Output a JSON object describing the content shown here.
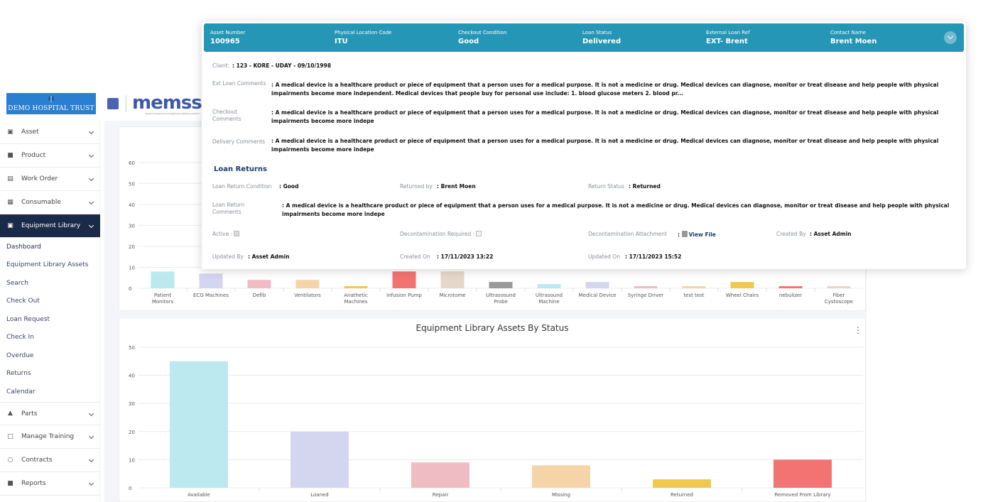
{
  "logo": {
    "text": "DEMO HOSPITAL TRUST",
    "brand": "memss",
    "brand_tag": "medical equipment management software solution"
  },
  "sidebar": {
    "items": [
      {
        "label": "Asset",
        "icon": "asset-icon"
      },
      {
        "label": "Product",
        "icon": "product-icon"
      },
      {
        "label": "Work Order",
        "icon": "work-order-icon"
      },
      {
        "label": "Consumable",
        "icon": "consumable-icon"
      },
      {
        "label": "Equipment Library",
        "icon": "equipment-library-icon"
      },
      {
        "label": "Parts",
        "icon": "parts-icon"
      },
      {
        "label": "Manage Training",
        "icon": "training-icon"
      },
      {
        "label": "Contracts",
        "icon": "contracts-icon"
      },
      {
        "label": "Reports",
        "icon": "reports-icon"
      }
    ],
    "sub_items": [
      "Dashboard",
      "Equipment Library Assets",
      "Search",
      "Check Out",
      "Loan Request",
      "Check In",
      "Overdue",
      "Returns",
      "Calendar"
    ]
  },
  "loan": {
    "header": [
      {
        "label": "Asset Number",
        "value": "100965"
      },
      {
        "label": "Physical Location Code",
        "value": "ITU"
      },
      {
        "label": "Checkout Condition",
        "value": "Good"
      },
      {
        "label": "Loan Status",
        "value": "Delivered"
      },
      {
        "label": "External Loan Ref",
        "value": "EXT- Brent"
      },
      {
        "label": "Contact Name",
        "value": "Brent Moen"
      }
    ],
    "client_label": "Client:",
    "client_value": ": 123 - KORE - UDAY - 09/10/1998",
    "ext_comments_label": "Ext Loan Comments",
    "ext_comments_value": ": A medical device is a healthcare product or piece of equipment that a person uses for a medical purpose. It is not a medicine or drug. Medical devices can diagnose, monitor or treat disease and help people with physical impairments become more independent. Medical devices that people buy for personal use include: 1. blood glucose meters 2. blood pr...",
    "checkout_comments_label": "Checkout Comments",
    "checkout_comments_value": ": A medical device is a healthcare product or piece of equipment that a person uses for a medical purpose. It is not a medicine or drug. Medical devices can diagnose, monitor or treat disease and help people with physical impairments become more indepe",
    "delivery_comments_label": "Delivery Comments",
    "delivery_comments_value": ": A medical device is a healthcare product or piece of equipment that a person uses for a medical purpose. It is not a medicine or drug. Medical devices can diagnose, monitor or treat disease and help people with physical impairments become more indepe",
    "returns_title": "Loan Returns",
    "return_condition_label": "Loan Return Condition",
    "return_condition_value": ": Good",
    "returned_by_label": "Returned by",
    "returned_by_value": ": Brent Moen",
    "return_status_label": "Return Status",
    "return_status_value": ": Returned",
    "return_comments_label": "Loan Return Comments",
    "return_comments_value": ": A medical device is a healthcare product or piece of equipment that a person uses for a medical purpose. It is not a medicine or drug. Medical devices can diagnose, monitor or treat disease and help people with physical impairments become more indepe",
    "active_label": "Active :",
    "decon_required_label": "Decontamination Required :",
    "decon_attachment_label": "Decontamination Attachment",
    "decon_attachment_sep": ":",
    "view_file": "View File",
    "created_by_label": "Created By",
    "created_by_value": ": Asset Admin",
    "updated_by_label": "Updated By",
    "updated_by_value": ": Asset Admin",
    "created_on_label": "Created On",
    "created_on_value": ": 17/11/2023 13:22",
    "updated_on_label": "Updated On",
    "updated_on_value": ": 17/11/2023 15:52"
  },
  "colors": {
    "accent": "#2596b5",
    "nav_active": "#1c2a4a",
    "brand": "#3e58a8"
  },
  "chart_data": [
    {
      "type": "bar",
      "title": "",
      "categories": [
        "Patient Monitors",
        "ECG Machines",
        "Defib",
        "Ventilators",
        "Anathetic Machines",
        "Infusion Pump",
        "Microtome",
        "Ultrasosund Probe",
        "Ultrasound Machine",
        "Medical Device",
        "Syringe Driver",
        "test test",
        "Wheel Chairs",
        "nebulizer",
        "Fiber Cystoscope"
      ],
      "values": [
        8,
        7,
        4,
        4,
        1,
        8,
        8,
        3,
        2,
        3,
        1,
        1,
        3,
        1,
        1
      ],
      "colors": [
        "#bce9f0",
        "#d4d6f0",
        "#f0bcc4",
        "#f5d4a8",
        "#f1c74c",
        "#f37373",
        "#e6d8c8",
        "#999999",
        "#bce9f0",
        "#d4d6f0",
        "#f0bcc4",
        "#f5d4a8",
        "#f1c74c",
        "#f37373",
        "#e6d8c8"
      ],
      "yticks": [
        0,
        10,
        20,
        30,
        40,
        50,
        60
      ],
      "ylim": [
        0,
        65
      ]
    },
    {
      "type": "bar",
      "title": "Equipment Library Assets By Status",
      "categories": [
        "Available",
        "Loaned",
        "Repair",
        "Missing",
        "Returned",
        "Removed From Library"
      ],
      "values": [
        45,
        20,
        9,
        8,
        3,
        10
      ],
      "colors": [
        "#bce9f0",
        "#d4d6f0",
        "#f0bcc4",
        "#f5d4a8",
        "#f1c74c",
        "#f37373"
      ],
      "yticks": [
        0,
        10,
        20,
        30,
        40,
        50
      ],
      "ylim": [
        0,
        51
      ]
    }
  ]
}
